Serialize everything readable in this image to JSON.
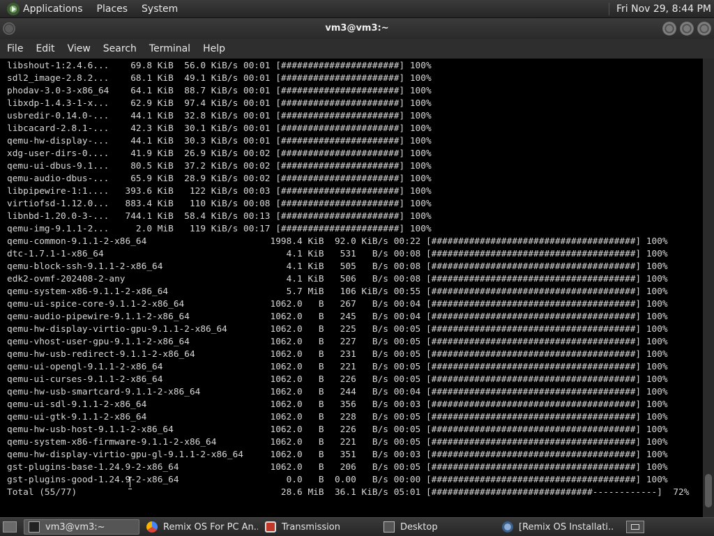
{
  "top_panel": {
    "menus": [
      "Applications",
      "Places",
      "System"
    ],
    "clock": "Fri Nov 29,  8:44 PM"
  },
  "window": {
    "title": "vm3@vm3:~"
  },
  "menubar": {
    "items": [
      "File",
      "Edit",
      "View",
      "Search",
      "Terminal",
      "Help"
    ]
  },
  "terminal": {
    "lines": [
      "libshout-1:2.4.6...    69.8 KiB  56.0 KiB/s 00:01 [######################] 100%",
      "sdl2_image-2.8.2...    68.1 KiB  49.1 KiB/s 00:01 [######################] 100%",
      "phodav-3.0-3-x86_64    64.1 KiB  88.7 KiB/s 00:01 [######################] 100%",
      "libxdp-1.4.3-1-x...    62.9 KiB  97.4 KiB/s 00:01 [######################] 100%",
      "usbredir-0.14.0-...    44.1 KiB  32.8 KiB/s 00:01 [######################] 100%",
      "libcacard-2.8.1-...    42.3 KiB  30.1 KiB/s 00:01 [######################] 100%",
      "qemu-hw-display-...    44.1 KiB  30.3 KiB/s 00:01 [######################] 100%",
      "xdg-user-dirs-0....    41.9 KiB  26.9 KiB/s 00:02 [######################] 100%",
      "qemu-ui-dbus-9.1...    80.5 KiB  37.2 KiB/s 00:02 [######################] 100%",
      "qemu-audio-dbus-...    65.9 KiB  28.9 KiB/s 00:02 [######################] 100%",
      "libpipewire-1:1....   393.6 KiB   122 KiB/s 00:03 [######################] 100%",
      "virtiofsd-1.12.0...   883.4 KiB   110 KiB/s 00:08 [######################] 100%",
      "libnbd-1.20.0-3-...   744.1 KiB  58.4 KiB/s 00:13 [######################] 100%",
      "qemu-img-9.1.1-2...     2.0 MiB   119 KiB/s 00:17 [######################] 100%",
      "qemu-common-9.1.1-2-x86_64                       1998.4 KiB  92.0 KiB/s 00:22 [######################################] 100%",
      "dtc-1.7.1-1-x86_64                                  4.1 KiB   531   B/s 00:08 [######################################] 100%",
      "qemu-block-ssh-9.1.1-2-x86_64                       4.1 KiB   505   B/s 00:08 [######################################] 100%",
      "edk2-ovmf-202408-2-any                              4.1 KiB   506   B/s 00:08 [######################################] 100%",
      "qemu-system-x86-9.1.1-2-x86_64                      5.7 MiB   106 KiB/s 00:55 [######################################] 100%",
      "qemu-ui-spice-core-9.1.1-2-x86_64                1062.0   B   267   B/s 00:04 [######################################] 100%",
      "qemu-audio-pipewire-9.1.1-2-x86_64               1062.0   B   245   B/s 00:04 [######################################] 100%",
      "qemu-hw-display-virtio-gpu-9.1.1-2-x86_64        1062.0   B   225   B/s 00:05 [######################################] 100%",
      "qemu-vhost-user-gpu-9.1.1-2-x86_64               1062.0   B   227   B/s 00:05 [######################################] 100%",
      "qemu-hw-usb-redirect-9.1.1-2-x86_64              1062.0   B   231   B/s 00:05 [######################################] 100%",
      "qemu-ui-opengl-9.1.1-2-x86_64                    1062.0   B   221   B/s 00:05 [######################################] 100%",
      "qemu-ui-curses-9.1.1-2-x86_64                    1062.0   B   226   B/s 00:05 [######################################] 100%",
      "qemu-hw-usb-smartcard-9.1.1-2-x86_64             1062.0   B   244   B/s 00:04 [######################################] 100%",
      "qemu-ui-sdl-9.1.1-2-x86_64                       1062.0   B   356   B/s 00:03 [######################################] 100%",
      "qemu-ui-gtk-9.1.1-2-x86_64                       1062.0   B   228   B/s 00:05 [######################################] 100%",
      "qemu-hw-usb-host-9.1.1-2-x86_64                  1062.0   B   226   B/s 00:05 [######################################] 100%",
      "qemu-system-x86-firmware-9.1.1-2-x86_64          1062.0   B   221   B/s 00:05 [######################################] 100%",
      "qemu-hw-display-virtio-gpu-gl-9.1.1-2-x86_64     1062.0   B   351   B/s 00:03 [######################################] 100%",
      "gst-plugins-base-1.24.9-2-x86_64                 1062.0   B   206   B/s 00:05 [######################################] 100%",
      "gst-plugins-good-1.24.9-2-x86_64                    0.0   B  0.00   B/s 00:00 [######################################] 100%",
      "Total (55/77)                                      28.6 MiB  36.1 KiB/s 05:01 [##############################------------]  72%"
    ]
  },
  "taskbar": {
    "tasks": [
      {
        "label": "vm3@vm3:~",
        "icon": "terminal-icon"
      },
      {
        "label": "Remix OS For PC An...",
        "icon": "chrome-icon"
      },
      {
        "label": "Transmission",
        "icon": "transmission-icon"
      },
      {
        "label": "Desktop",
        "icon": "folder-icon"
      },
      {
        "label": "[Remix OS Installati...",
        "icon": "messenger-icon"
      }
    ]
  }
}
